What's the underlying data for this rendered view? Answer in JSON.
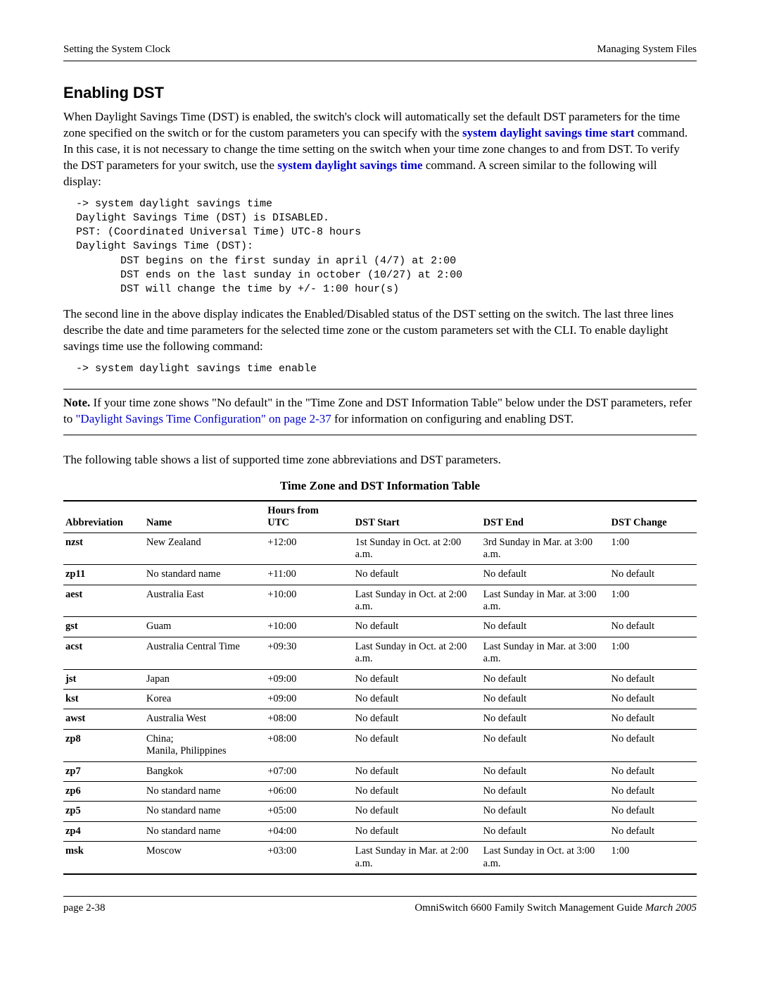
{
  "header": {
    "left": "Setting the System Clock",
    "right": "Managing System Files"
  },
  "section_title": "Enabling DST",
  "para1_a": "When Daylight Savings Time (DST) is enabled, the switch's clock will automatically set the default DST parameters for the time zone specified on the switch or for the custom parameters you can specify with the ",
  "link1": "system daylight savings time start",
  "para1_b": " command. In this case, it is not necessary to change the time setting on the switch when your time zone changes to and from DST. To verify the DST parameters for your switch, use the ",
  "link2": "system daylight savings time",
  "para1_c": " command. A screen similar to the following will display:",
  "code1": "-> system daylight savings time\nDaylight Savings Time (DST) is DISABLED.\nPST: (Coordinated Universal Time) UTC-8 hours\nDaylight Savings Time (DST):\n       DST begins on the first sunday in april (4/7) at 2:00\n       DST ends on the last sunday in october (10/27) at 2:00\n       DST will change the time by +/- 1:00 hour(s)",
  "para2": "The second line in the above display indicates the Enabled/Disabled status of the DST setting on the switch. The last three lines describe the date and time parameters for the selected time zone or the custom parameters set with the CLI. To enable daylight savings time use the following command:",
  "code2": "-> system daylight savings time enable",
  "note_label": "Note.",
  "note_a": " If your time zone shows \"No default\" in the \"Time Zone and DST Information Table\" below under the DST parameters, refer to ",
  "note_link": "\"Daylight Savings Time Configuration\" on page 2-37",
  "note_b": " for information on configuring and enabling DST.",
  "para3": "The following table shows a list of supported time zone abbreviations and DST parameters.",
  "table_caption": "Time Zone and DST Information Table",
  "table": {
    "headers": {
      "abbr": "Abbreviation",
      "name": "Name",
      "utc": "Hours from\nUTC",
      "start": "DST Start",
      "end": "DST End",
      "change": "DST Change"
    },
    "rows": [
      {
        "abbr": "nzst",
        "name": "New Zealand",
        "utc": "+12:00",
        "start": "1st Sunday in Oct. at 2:00 a.m.",
        "end": "3rd Sunday in Mar. at 3:00 a.m.",
        "change": "1:00"
      },
      {
        "abbr": "zp11",
        "name": "No standard name",
        "utc": "+11:00",
        "start": "No default",
        "end": "No default",
        "change": "No default"
      },
      {
        "abbr": "aest",
        "name": "Australia East",
        "utc": "+10:00",
        "start": "Last Sunday in Oct. at 2:00 a.m.",
        "end": "Last Sunday in Mar. at 3:00 a.m.",
        "change": "1:00"
      },
      {
        "abbr": "gst",
        "name": "Guam",
        "utc": "+10:00",
        "start": "No default",
        "end": "No default",
        "change": "No default"
      },
      {
        "abbr": "acst",
        "name": "Australia Central Time",
        "utc": "+09:30",
        "start": "Last Sunday in Oct. at 2:00 a.m.",
        "end": "Last Sunday in Mar. at 3:00 a.m.",
        "change": "1:00"
      },
      {
        "abbr": "jst",
        "name": "Japan",
        "utc": "+09:00",
        "start": "No default",
        "end": "No default",
        "change": "No default"
      },
      {
        "abbr": "kst",
        "name": "Korea",
        "utc": "+09:00",
        "start": "No default",
        "end": "No default",
        "change": "No default"
      },
      {
        "abbr": "awst",
        "name": "Australia West",
        "utc": "+08:00",
        "start": "No default",
        "end": "No default",
        "change": "No default"
      },
      {
        "abbr": "zp8",
        "name": "China;\nManila, Philippines",
        "utc": "+08:00",
        "start": "No default",
        "end": "No default",
        "change": "No default"
      },
      {
        "abbr": "zp7",
        "name": "Bangkok",
        "utc": "+07:00",
        "start": "No default",
        "end": "No default",
        "change": "No default"
      },
      {
        "abbr": "zp6",
        "name": "No standard name",
        "utc": "+06:00",
        "start": "No default",
        "end": "No default",
        "change": "No default"
      },
      {
        "abbr": "zp5",
        "name": "No standard name",
        "utc": "+05:00",
        "start": "No default",
        "end": "No default",
        "change": "No default"
      },
      {
        "abbr": "zp4",
        "name": "No standard name",
        "utc": "+04:00",
        "start": "No default",
        "end": "No default",
        "change": "No default"
      },
      {
        "abbr": "msk",
        "name": "Moscow",
        "utc": "+03:00",
        "start": "Last Sunday in Mar. at 2:00 a.m.",
        "end": "Last Sunday in Oct. at 3:00 a.m.",
        "change": "1:00"
      }
    ]
  },
  "footer": {
    "left": "page 2-38",
    "right_a": "OmniSwitch 6600 Family Switch Management Guide    ",
    "right_b": "March 2005"
  }
}
